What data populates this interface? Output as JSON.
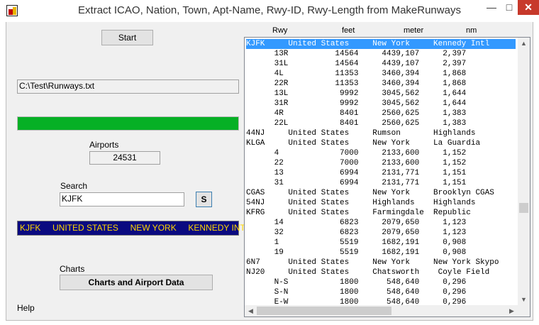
{
  "window": {
    "title": "Extract ICAO, Nation, Town, Apt-Name, Rwy-ID, Rwy-Length from MakeRunways",
    "minimize": "—",
    "maximize": "□",
    "close": "✕"
  },
  "left": {
    "start_label": "Start",
    "file_path": "C:\\Test\\Runways.txt",
    "progress_pct": 100,
    "airports_label": "Airports",
    "airports_count": "24531",
    "search_label": "Search",
    "search_value": "KJFK",
    "search_button": "S",
    "result_text": "KJFK     UNITED STATES     NEW YORK     KENNEDY INTL",
    "charts_label": "Charts",
    "charts_button": "Charts and Airport Data",
    "help_label": "Help"
  },
  "table": {
    "headers": [
      "Rwy",
      "feet",
      "meter",
      "nm"
    ],
    "rows": [
      "KJFK     United States     New York     Kennedy Intl",
      "      13R          14564     4439,107     2,397",
      "      31L          14564     4439,107     2,397",
      "      4L           11353     3460,394     1,868",
      "      22R          11353     3460,394     1,868",
      "      13L           9992     3045,562     1,644",
      "      31R           9992     3045,562     1,644",
      "      4R            8401     2560,625     1,383",
      "      22L           8401     2560,625     1,383",
      "44NJ     United States     Rumson       Highlands",
      "KLGA     United States     New York     La Guardia",
      "      4             7000     2133,600     1,152",
      "      22            7000     2133,600     1,152",
      "      13            6994     2131,771     1,151",
      "      31            6994     2131,771     1,151",
      "CGAS     United States     New York     Brooklyn CGAS",
      "54NJ     United States     Highlands    Highlands",
      "KFRG     United States     Farmingdale  Republic",
      "      14            6823     2079,650     1,123",
      "      32            6823     2079,650     1,123",
      "      1             5519     1682,191     0,908",
      "      19            5519     1682,191     0,908",
      "6N7      United States     New York     New York Skypo",
      "NJ20     United States     Chatsworth    Coyle Field",
      "      N-S           1800      548,640     0,296",
      "      S-N           1800      548,640     0,296",
      "      E-W           1800      548,640     0,296"
    ],
    "selected_index": 0
  },
  "colors": {
    "selection": "#3399ff",
    "progress": "#06b025",
    "result_bg": "#0a0a80",
    "result_text": "#ffd700",
    "close_button": "#c7392b"
  },
  "icons": [
    "app-icon",
    "minimize-icon",
    "maximize-icon",
    "close-icon",
    "scroll-up-arrow-icon",
    "scroll-down-arrow-icon",
    "scroll-left-arrow-icon",
    "scroll-right-arrow-icon"
  ]
}
